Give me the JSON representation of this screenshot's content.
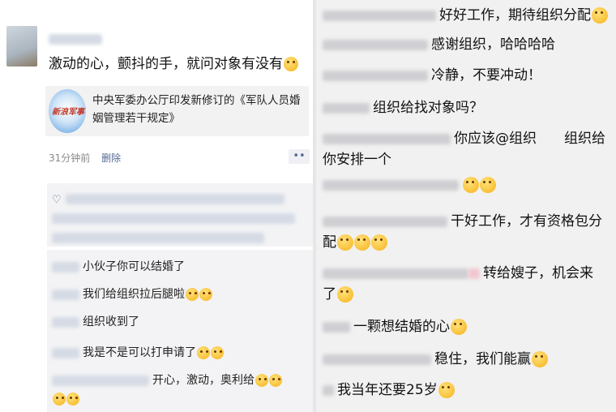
{
  "post": {
    "text": "激动的心，颤抖的手，就问对象有没有",
    "link_title": "中央军委办公厅印发新修订的《军队人员婚姻管理若干规定》",
    "link_thumb_text": "新浪军事",
    "time": "31分钟前",
    "delete_label": "删除",
    "more_label": "••"
  },
  "likes_icon": "heart-outline-icon",
  "left_comments": [
    {
      "text": "小伙子你可以结婚了",
      "emojis": []
    },
    {
      "text": "我们给组织拉后腿啦",
      "emojis": [
        "grin-sweat",
        "grin-sweat"
      ]
    },
    {
      "text": "组织收到了",
      "emojis": []
    },
    {
      "text": "我是不是可以打申请了",
      "emojis": [
        "tongue",
        "tongue"
      ]
    },
    {
      "text": "开心，激动，奥利给",
      "emojis": [
        "sunglasses",
        "monocle",
        "hand-over-mouth",
        "smile"
      ]
    }
  ],
  "right_comments": [
    {
      "text": "好好工作，期待组织分配",
      "emojis": [
        "grin"
      ]
    },
    {
      "text": "感谢组织，哈哈哈哈",
      "emojis": []
    },
    {
      "text": "冷静，不要冲动！",
      "emojis": []
    },
    {
      "text": "组织给找对象吗？",
      "emojis": []
    },
    {
      "text": "你应该@组织　　组织给",
      "emojis": []
    },
    {
      "text": "你安排一个",
      "emojis": []
    },
    {
      "text": "",
      "emojis": [
        "grin",
        "grin"
      ]
    },
    {
      "text": "干好工作，才有资格包分",
      "emojis": []
    },
    {
      "text": "配",
      "emojis": [
        "thinking",
        "thinking",
        "thinking"
      ]
    },
    {
      "text": "转给嫂子，机会来",
      "emojis": []
    },
    {
      "text": "了",
      "emojis": [
        "grin"
      ]
    },
    {
      "text": "一颗想结婚的心",
      "emojis": [
        "grimace"
      ]
    },
    {
      "text": "稳住，我们能赢",
      "emojis": [
        "monocle"
      ]
    },
    {
      "text": "我当年还要25岁",
      "emojis": [
        "sweat"
      ]
    }
  ]
}
